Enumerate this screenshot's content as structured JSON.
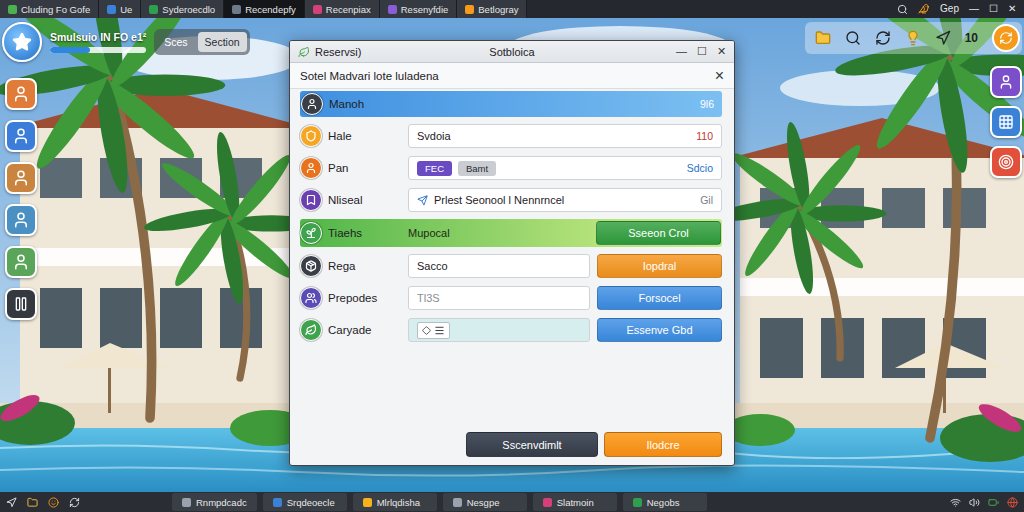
{
  "browser": {
    "tabs": [
      {
        "label": "Cluding Fo Gofe",
        "selected": false
      },
      {
        "label": "Ue",
        "selected": false
      },
      {
        "label": "Syderoecdlo",
        "selected": false
      },
      {
        "label": "Recendepfy",
        "selected": true
      },
      {
        "label": "Recenpiax",
        "selected": false
      },
      {
        "label": "Resenyfdie",
        "selected": false
      },
      {
        "label": "Betlogray",
        "selected": false
      }
    ],
    "user": "Gep",
    "controls": [
      "—",
      "☐",
      "✕"
    ]
  },
  "hud": {
    "title": "Smulsuio IN FO e1²",
    "xp": {
      "level": 0.42
    },
    "chips": [
      {
        "label": "Sces",
        "selected": false
      },
      {
        "label": "Section",
        "selected": true
      }
    ],
    "counter": "10"
  },
  "dialog": {
    "title": "Reservsi)",
    "heading": "Sotbloica",
    "controls": [
      "—",
      "☐",
      "✕"
    ],
    "subtitle": "Sotel Madvari lote luladena",
    "close": "×",
    "rows": [
      {
        "kind": "header",
        "label": "Manoh",
        "value": "9l6"
      },
      {
        "kind": "field",
        "label": "Hale",
        "text": "Svdoia",
        "value": "110",
        "value_color": "#c0392b"
      },
      {
        "kind": "chips",
        "label": "Pan",
        "chips": [
          {
            "label": "FEC",
            "color": "#6a4bc4"
          },
          {
            "label": "Bamt",
            "color": "#c9ccd1"
          }
        ],
        "value": "Sdcio",
        "value_color": "#2a6fc9"
      },
      {
        "kind": "link",
        "label": "Nliseal",
        "text": "Prlest Seonool l Nennrncel",
        "value": "Gil",
        "value_color": "#7a7f87"
      },
      {
        "kind": "section",
        "label": "Tiaehs",
        "text": "Mupocal",
        "button": "Sseeon Crol",
        "color": "#2f9e3c"
      },
      {
        "kind": "action",
        "label": "Rega",
        "text": "Sacco",
        "muted": false,
        "button": "Iopdral",
        "color": "#f5941c"
      },
      {
        "kind": "action",
        "label": "Prepodes",
        "text": "Tl3S",
        "muted": true,
        "button": "Forsocel",
        "color": "#3b8de4"
      },
      {
        "kind": "picker",
        "label": "Caryade",
        "button": "Essenve Gbd",
        "color": "#3b8de4"
      }
    ],
    "buttons": [
      {
        "label": "Sscenvdimlt",
        "primary": false
      },
      {
        "label": "Ilodcre",
        "primary": true
      }
    ]
  },
  "taskbar": {
    "items": [
      {
        "label": "Rnmpdcadc",
        "selected": false
      },
      {
        "label": "Srqdeoecle",
        "selected": false
      },
      {
        "label": "Mlrlqdisha",
        "selected": false
      },
      {
        "label": "Nesgpe",
        "selected": false
      },
      {
        "label": "Slatmoin",
        "selected": false
      },
      {
        "label": "Negobs",
        "selected": false
      }
    ]
  }
}
